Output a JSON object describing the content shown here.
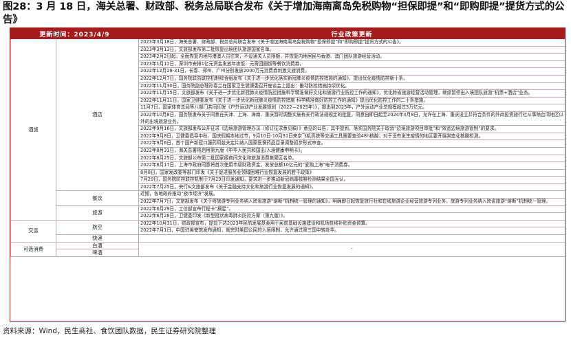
{
  "title": "图28：3 月 18 日，海关总署、财政部、税务总局联合发布《关于增加海南离岛免税购物“担保即提”和“即购即提”提货方式的公告》",
  "header": {
    "left": "更新时间：2023/4/9",
    "right": "行业政策更新"
  },
  "categories": {
    "hotel_tourism": "酒旅",
    "hotel": "酒店",
    "catering": "餐饮",
    "tourism": "旅游",
    "transport": "交运",
    "aviation": "航空",
    "express": "快递",
    "optional": "可选消费",
    "baijiu": "白酒",
    "beer": "啤酒",
    "dash": "-"
  },
  "hotel_items": [
    "2023年3月18日，海关总署、财政部、税务总局联合发布《关于增加海南离岛免税购物“担保即提”和“即购即提”提货方式的公告》。",
    "2023年3月13日，文旅部发布第二批恢复出境团队旅游国家名单。",
    "2023年2月2日起，全面恢复内地与港澳人员往来，不设通关人员限额，并恢复内地居民与香港、澳门团队旅游经营活动。",
    "2023年1月12日，深圳市安排1亿元资金发放年夜饭、元宵团圆饭等餐饮消费券。",
    "2022年12月28-31日，长春、郑州、广州分别发放2000万元消费券刺激文旅消费。",
    "2022年12月7日，国务院联防联控机制综合组发布《关于进一步优化落实新冠肺炎疫情防控措施的通知》，提出优化疫情防控新十条。",
    "2022年11月30日，国务院副总理孙春兰在国家卫生健康委召开座谈会上提出：推动防控措施持续优化。",
    "2022年11月15日，文旅部发布《关于进一步优化新冠肺炎疫情防控措施科学精准做好文化和旅游行业防控工作的通知》，优化跨省旅游经营活动管理，继续暂停出入境团队旅游“机票+酒店”业务。",
    "2022年11月11日，国家卫健委发布《关于进一步优化新冠肺炎疫情防控措施 科学精准做好防控工作的通知》提出优化防控工作的二十条措施。",
    "11月7日，国家体育总局等八部门共同印发《户外运动产业发展规划（2022—2025年）》，提出到2025年，户外运动产业总规模超过3万亿元。",
    "2022年10月8日，国务院发布关于同意在天津、上海、海南、重庆暂时调整实施有关行政法规规定的批复，同意自即日起至2024年4月8日，允许在上海、重庆设立并符合条件的外商投资旅行社从事除台湾地区以外的出境旅游业务。",
    "2022年9月16日，文旅部发布公开征求《边境旅游管理办法（修订征求意见稿）》意见的公告，其中提到，落实国务院关于取消“边境旅游项目审批”和“效宽边境旅游管制”的要求。",
    "2022年9月8日，卫健委倡导中秋、国庆假期本地过节，9月10日-10月31日来京飞机高铁等交通工具需要查验48h核酸；对于没有发生疫情的地区要开展常态化核酸检测。",
    "2022年9月6日，首个国产新冠口服药阿兹夫定片纳入国家医保药品目录调整初步形式审查。",
    "2022年8月31日，海关总署将启用第九版《中华人民共和国出/入境健康申明卡》。",
    "2022年8月25日，文旅部公布第二批国家级夜间文化和旅游消费集聚区名单。",
    "2022年8月17日，上海市政府同意将首次使用市级财政资金，发放总额10亿元的“爱购上海”电子消费券。",
    "8月8日，国家发改委等部门印发《关于促进服务业领域困难行业恢复发展的若干政策》",
    "7月29日，国务院防控联控机制于7月29日印发通知，要求进一步推动新冠病毒核酸检测结果全国互认。",
    "2022年7月25日，央行&文旅部发布《关于金融支持文化和旅游行业恢复发展的通知》。"
  ],
  "catering_items": [
    "近期，各地政府推动“夜市经济”发展。",
    "2022年7月7日，文旅部发布《关于将旅游专列业务纳入跨省旅游“熔断”机制统一管理的通知》，明确即日起恢复旅行社和在线旅游企业经营旅游专列业务，旅游专列业务纳入跨省旅游“熔断”机制统一管理。"
  ],
  "tourism_items": [
    "2022年6月29日，工信部宣布行程卡“摘星”。",
    "2022年6月28日，卫健委印发《新型冠状病毒肺炎防控方案（第九版）》。"
  ],
  "aviation_items": [
    "2022年10月31日，财政部宣布，提前下达2023年民航发展基金用于民航基础设施建设和机场航线补贴资金预算。",
    "2022年7月1日，中国驻美使馆发布通知，就完时美国公民的入境限制，允许通过第三国中转赴华。"
  ],
  "footer": "资料来源：Wind，民生商社、食饮团队数据，民生证券研究院整理"
}
